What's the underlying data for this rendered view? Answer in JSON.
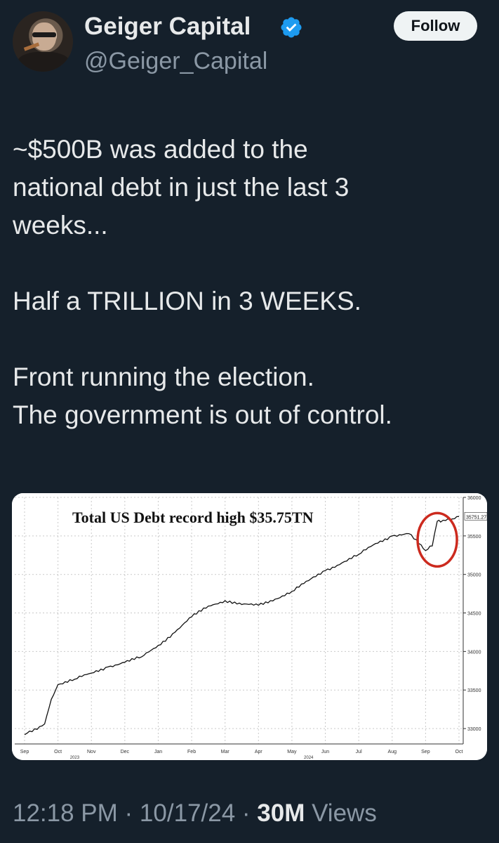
{
  "author": {
    "name": "Geiger Capital",
    "handle": "@Geiger_Capital",
    "verified_icon": "verified-badge-icon",
    "follow_label": "Follow"
  },
  "tweet": {
    "text": "~$500B was added to the\nnational debt in just the last 3\nweeks...\n\nHalf a TRILLION in 3 WEEKS.\n\nFront running the election.\nThe government is out of control."
  },
  "meta": {
    "time": "12:18 PM",
    "sep1": " · ",
    "date": "10/17/24",
    "sep2": " · ",
    "views_count": "30M",
    "views_label": " Views"
  },
  "colors": {
    "background": "#15202b",
    "text": "#e7e9ea",
    "secondary": "#8b98a5",
    "verified": "#1d9bf0",
    "circle": "#cc2a1e"
  },
  "chart_data": {
    "type": "line",
    "title": "Total US Debt record high $35.75TN",
    "last_value_label": "35751.27",
    "x_ticks": [
      "Sep",
      "Oct",
      "Nov",
      "Dec",
      "Jan",
      "Feb",
      "Mar",
      "Apr",
      "May",
      "Jun",
      "Jul",
      "Aug",
      "Sep",
      "Oct"
    ],
    "year_labels": [
      "2023",
      "2024"
    ],
    "y_ticks": [
      33000,
      33500,
      34000,
      34500,
      35000,
      35500,
      36000
    ],
    "ylim": [
      32800,
      36000
    ],
    "series": [
      {
        "x": [
          0,
          0.6,
          0.8,
          1.0,
          1.5,
          2.0,
          2.5,
          3.0,
          3.5,
          4.0,
          4.5,
          5.0,
          5.5,
          6.0,
          6.5,
          7.0,
          7.5,
          8.0,
          8.5,
          9.0,
          9.5,
          10.0,
          10.5,
          11.0,
          11.5,
          11.8,
          12.0,
          12.2,
          12.35,
          12.45,
          12.6,
          12.8,
          13.0
        ],
        "y": [
          32920,
          33060,
          33380,
          33570,
          33640,
          33720,
          33800,
          33860,
          33930,
          34080,
          34250,
          34450,
          34590,
          34660,
          34610,
          34600,
          34680,
          34780,
          34920,
          35050,
          35150,
          35260,
          35400,
          35500,
          35530,
          35400,
          35310,
          35370,
          35690,
          35680,
          35700,
          35720,
          35751
        ]
      }
    ],
    "grid": true,
    "annotation": "red circle around latest spike"
  }
}
